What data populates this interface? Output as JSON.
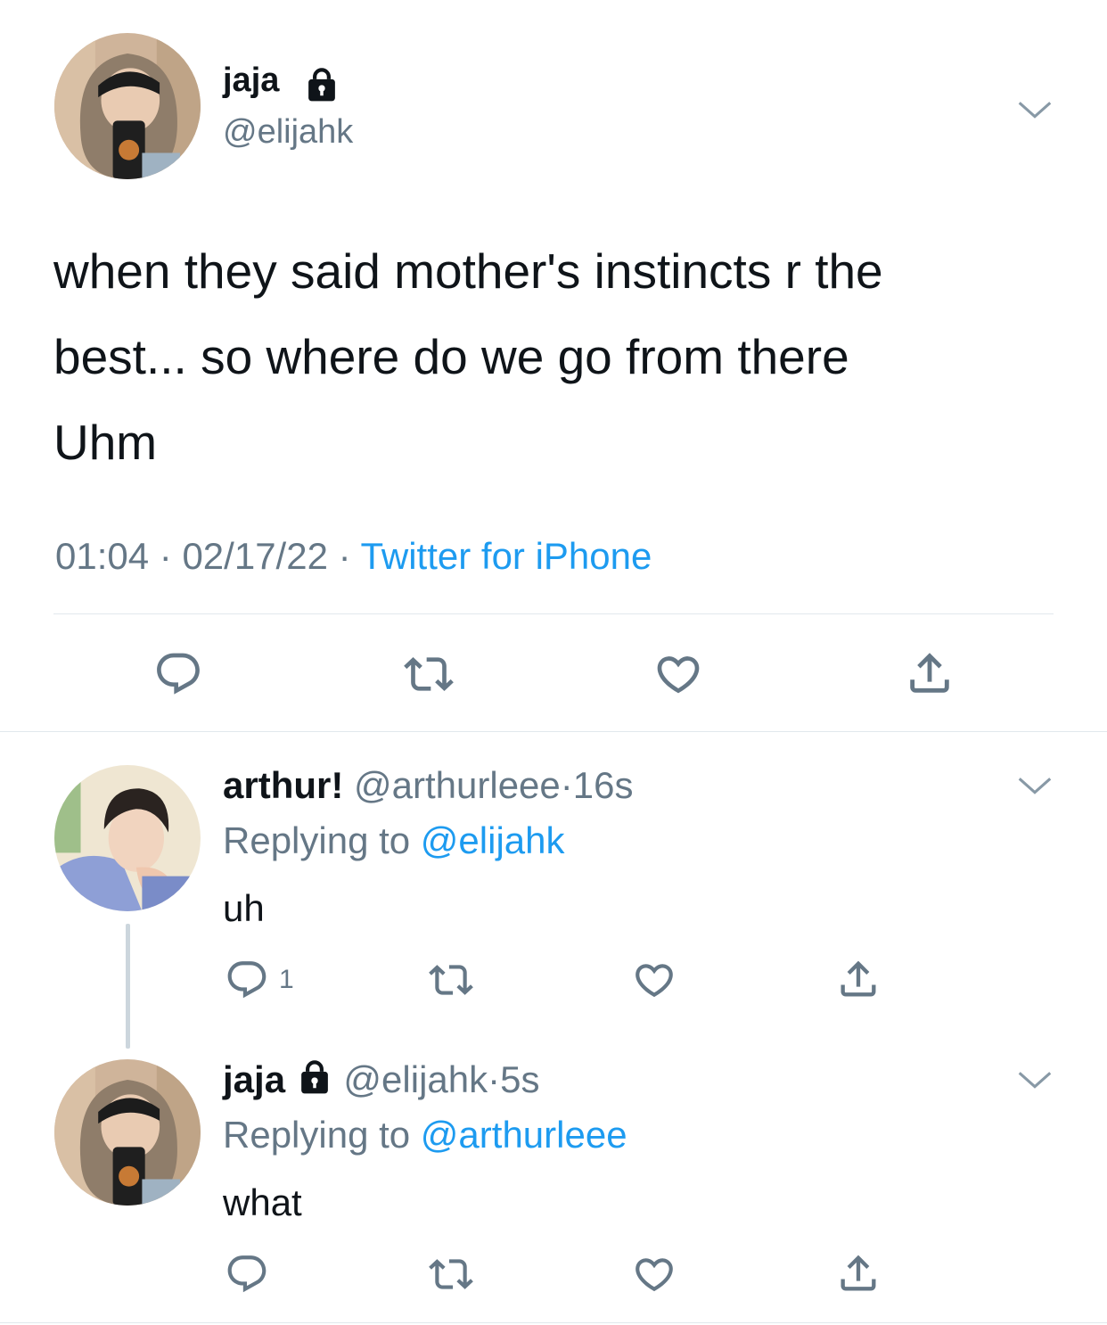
{
  "main_tweet": {
    "display_name": "jaja",
    "handle": "@elijahk",
    "text_lines": [
      "when they said mother's instincts r the",
      "best... so where do we go from there",
      "Uhm"
    ],
    "time": "01:04",
    "date": "02/17/22",
    "sep": "·",
    "source": "Twitter for iPhone"
  },
  "reply_1": {
    "display_name": "arthur!",
    "handle": "@arthurleee",
    "sep": "·",
    "age": "16s",
    "replying_prefix": "Replying to",
    "replying_to": "@elijahk",
    "text": "uh",
    "reply_count": "1"
  },
  "reply_2": {
    "display_name": "jaja",
    "handle": "@elijahk",
    "sep": "·",
    "age": "5s",
    "replying_prefix": "Replying to",
    "replying_to": "@arthurleee",
    "text": "what"
  },
  "icons": {
    "lock": "lock-icon",
    "reply": "reply-icon",
    "retweet": "retweet-icon",
    "like": "heart-icon",
    "share": "share-icon",
    "more": "chevron-down-icon"
  },
  "colors": {
    "text": "#0f1419",
    "secondary": "#657786",
    "link": "#1d9bf0",
    "divider": "#e1e8ed",
    "thread_line": "#ccd6dd"
  }
}
